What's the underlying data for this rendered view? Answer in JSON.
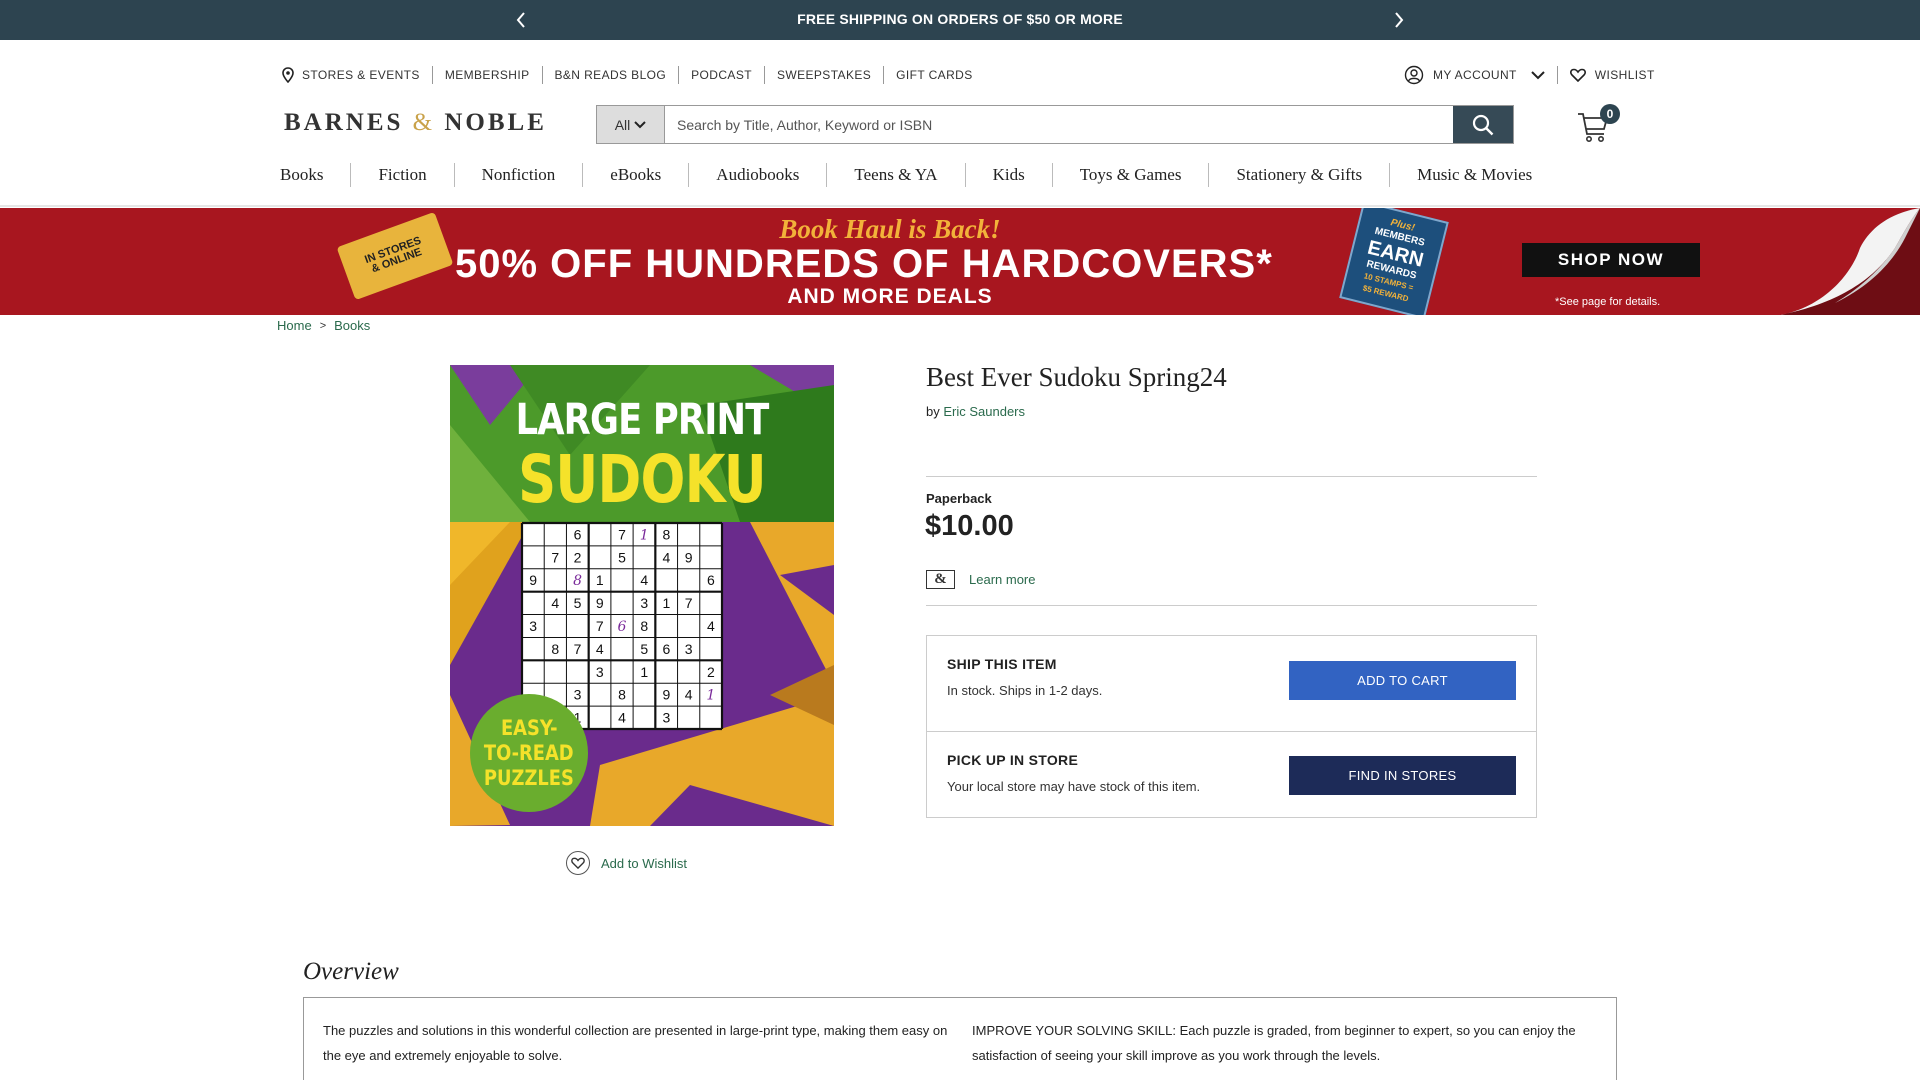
{
  "promo": {
    "message": "FREE SHIPPING ON ORDERS OF $50 OR MORE"
  },
  "utility_nav": [
    "STORES & EVENTS",
    "MEMBERSHIP",
    "B&N READS BLOG",
    "PODCAST",
    "SWEEPSTAKES",
    "GIFT CARDS"
  ],
  "account": {
    "my_account": "MY ACCOUNT",
    "wishlist": "WISHLIST"
  },
  "logo": {
    "left": "BARNES",
    "amp": "&",
    "right": "NOBLE"
  },
  "search": {
    "scope": "All",
    "placeholder": "Search by Title, Author, Keyword or ISBN"
  },
  "cart": {
    "count": "0"
  },
  "main_nav": [
    "Books",
    "Fiction",
    "Nonfiction",
    "eBooks",
    "Audiobooks",
    "Teens & YA",
    "Kids",
    "Toys & Games",
    "Stationery & Gifts",
    "Music & Movies"
  ],
  "banner": {
    "tag_line1": "IN STORES",
    "tag_line2": "& ONLINE",
    "headline": "Book Haul is Back!",
    "offer": "50% OFF HUNDREDS OF HARDCOVERS*",
    "sub": "AND MORE DEALS",
    "badge_plus": "Plus!",
    "badge_members": "MEMBERS",
    "badge_earn": "EARN",
    "badge_rewards": "REWARDS",
    "badge_stamps": "10 STAMPS =",
    "badge_reward": "$5 REWARD",
    "cta": "SHOP NOW",
    "fine_print": "*See page for details."
  },
  "breadcrumb": {
    "home": "Home",
    "sep": ">",
    "current": "Books"
  },
  "cover": {
    "line1": "LARGE PRINT",
    "line2": "SUDOKU",
    "sticker1": "EASY-",
    "sticker2": "TO-READ",
    "sticker3": "PUZZLES",
    "grid": [
      [
        "",
        "",
        "6",
        "",
        "7",
        "1",
        "8",
        "",
        ""
      ],
      [
        "",
        "7",
        "2",
        "",
        "5",
        "",
        "4",
        "9",
        ""
      ],
      [
        "9",
        "",
        "8",
        "1",
        "",
        "4",
        "",
        "",
        "6"
      ],
      [
        "",
        "4",
        "5",
        "9",
        "",
        "3",
        "1",
        "7",
        ""
      ],
      [
        "3",
        "",
        "",
        "7",
        "6",
        "8",
        "",
        "",
        "4"
      ],
      [
        "",
        "8",
        "7",
        "4",
        "",
        "5",
        "6",
        "3",
        ""
      ],
      [
        "",
        "",
        "",
        "3",
        "",
        "1",
        "",
        "",
        "2"
      ],
      [
        "",
        "",
        "3",
        "",
        "8",
        "",
        "9",
        "4",
        "1"
      ],
      [
        "",
        "",
        "1",
        "",
        "4",
        "",
        "3",
        "",
        ""
      ]
    ],
    "handwritten": [
      "0-5",
      "2-2",
      "4-4",
      "7-8"
    ]
  },
  "wishlist_link": "Add to Wishlist",
  "product": {
    "title": "Best Ever Sudoku Spring24",
    "by": "by",
    "author": "Eric Saunders",
    "format": "Paperback",
    "price": "$10.00",
    "member_logo": "&",
    "learn_more": "Learn more"
  },
  "buy": {
    "ship_heading": "SHIP THIS ITEM",
    "ship_status": "In stock. Ships in 1-2 days.",
    "add_to_cart": "ADD TO CART",
    "pickup_heading": "PICK UP IN STORE",
    "pickup_status": "Your local store may have stock of this item.",
    "find_in_stores": "FIND IN STORES"
  },
  "overview": {
    "title": "Overview",
    "col1": "The puzzles and solutions in this wonderful collection are presented in large-print type, making them easy on the eye and extremely enjoyable to solve.",
    "col2": "IMPROVE YOUR SOLVING SKILL: Each puzzle is graded, from beginner to expert, so you can enjoy the satisfaction of seeing your skill improve as you work through the levels."
  },
  "colors": {
    "promo_bar": "#2d4450",
    "link_green": "#2a6a4c",
    "add_to_cart": "#3263c2",
    "find_in_stores": "#1d2b58",
    "banner_red": "#a8161f",
    "banner_gold": "#f2b23a"
  },
  "icons": [
    "chevron-left-icon",
    "chevron-right-icon",
    "location-pin-icon",
    "user-icon",
    "chevron-down-icon",
    "heart-icon",
    "search-icon",
    "cart-icon"
  ]
}
